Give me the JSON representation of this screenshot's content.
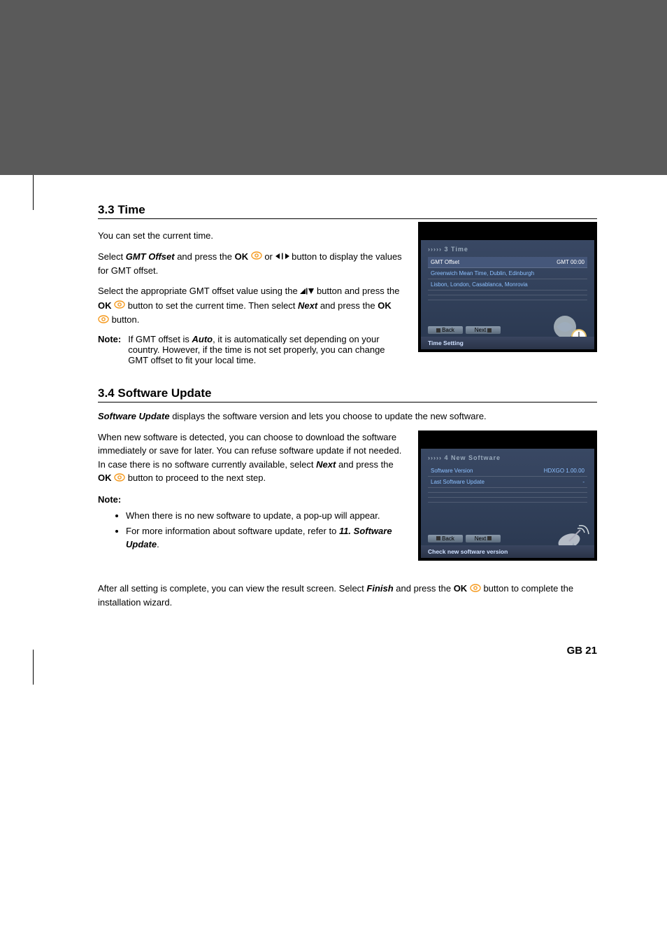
{
  "sections": {
    "time": {
      "heading": "3.3 Time",
      "intro": "You can set the current time.",
      "p1_a": "Select ",
      "p1_b": "GMT Offset",
      "p1_c": " and press the ",
      "p1_d": "OK",
      "p1_e": " or ",
      "p1_f": " button to display the values for GMT offset.",
      "p2_a": "Select the appropriate GMT offset value using the ",
      "p2_b": " button and press the ",
      "p2_c": "OK",
      "p2_d": " button to set the current time. Then select ",
      "p2_e": "Next",
      "p2_f": " and press the ",
      "p2_g": "OK",
      "p2_h": " button.",
      "note_label": "Note:",
      "note_a": "If GMT offset is ",
      "note_b": "Auto",
      "note_c": ", it is automatically set depending on your country. However, if the time is not set properly, you can change GMT offset to fit your local time."
    },
    "sw": {
      "heading": "3.4 Software Update",
      "p1_a": "Software Update",
      "p1_b": " displays the software version and lets you choose to update the new software.",
      "p2_a": "When new software is detected, you can choose to download the software immediately or save for later. You can refuse software update if not needed. In case there is no software currently available, select ",
      "p2_b": "Next",
      "p2_c": " and press the ",
      "p2_d": "OK",
      "p2_e": " button to proceed to the next step.",
      "note_label": "Note:",
      "li1": "When there is no new software to update, a pop-up will appear.",
      "li2_a": "For more information about software update, refer to ",
      "li2_b": "11. Software Update",
      "li2_c": "."
    },
    "closing": {
      "a": "After all setting is complete, you can view the result screen. Select ",
      "b": "Finish",
      "c": " and press the ",
      "d": "OK",
      "e": " button to complete the installation wizard."
    }
  },
  "fig_time": {
    "crumb": "3 Time",
    "row1_label": "GMT Offset",
    "row1_value": "GMT 00:00",
    "row2": "Greenwich Mean Time, Dublin, Edinburgh",
    "row3": "Lisbon, London, Casablanca, Monrovia",
    "btn_back": "Back",
    "btn_next": "Next",
    "footer": "Time Setting"
  },
  "fig_sw": {
    "crumb": "4 New Software",
    "row1_label": "Software Version",
    "row1_value": "HDXGO 1.00.00",
    "row2_label": "Last Software Update",
    "row2_value": "-",
    "btn_back": "Back",
    "btn_next": "Next",
    "footer": "Check new software version"
  },
  "page_number": "GB 21"
}
